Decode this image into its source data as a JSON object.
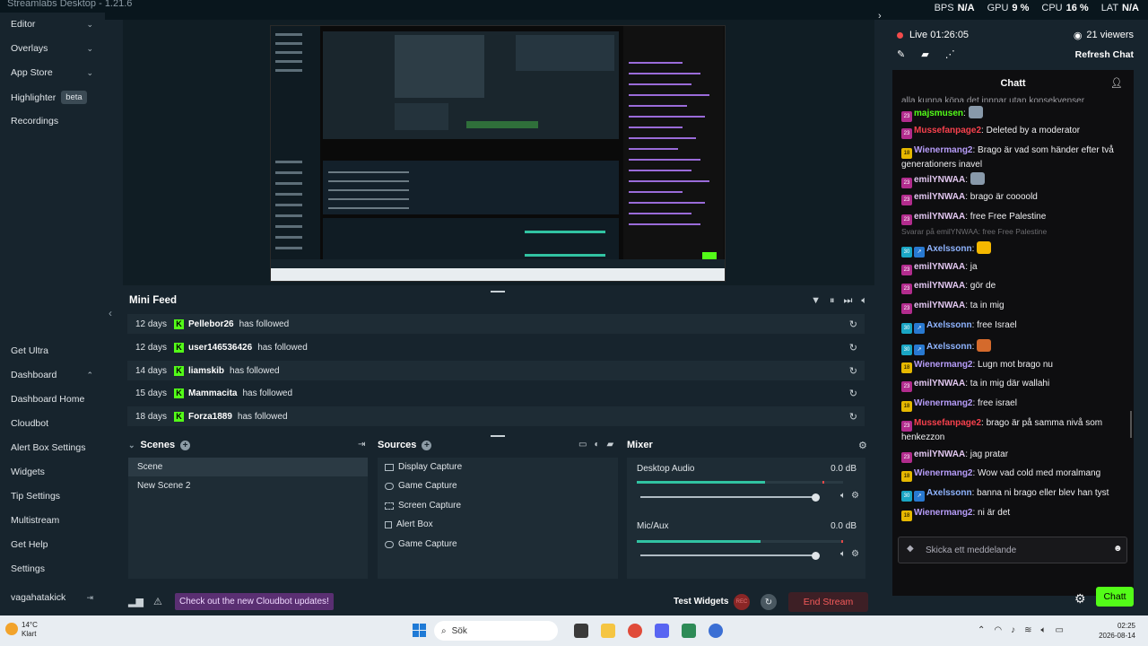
{
  "window": {
    "title": "Streamlabs Desktop - 1.21.6"
  },
  "stats": [
    {
      "label": "BPS",
      "value": "N/A"
    },
    {
      "label": "GPU",
      "value": "9 %"
    },
    {
      "label": "CPU",
      "value": "16 %"
    },
    {
      "label": "LAT",
      "value": "N/A"
    }
  ],
  "sidebar": {
    "top_items": [
      {
        "label": "Editor",
        "chevron": "down"
      },
      {
        "label": "Overlays",
        "chevron": "down"
      },
      {
        "label": "App Store",
        "chevron": "down"
      },
      {
        "label": "Highlighter",
        "badge": "beta"
      },
      {
        "label": "Recordings"
      }
    ],
    "bottom_items": [
      {
        "label": "Get Ultra"
      },
      {
        "label": "Dashboard",
        "chevron": "up"
      },
      {
        "label": "Dashboard Home"
      },
      {
        "label": "Cloudbot"
      },
      {
        "label": "Alert Box Settings"
      },
      {
        "label": "Widgets"
      },
      {
        "label": "Tip Settings"
      },
      {
        "label": "Multistream"
      },
      {
        "label": "Get Help"
      },
      {
        "label": "Settings"
      }
    ],
    "user": "vagahatakick"
  },
  "minifeed": {
    "title": "Mini Feed",
    "rows": [
      {
        "time": "12 days",
        "user": "Pellebor26",
        "action": "has followed"
      },
      {
        "time": "12 days",
        "user": "user146536426",
        "action": "has followed"
      },
      {
        "time": "14 days",
        "user": "liamskib",
        "action": "has followed"
      },
      {
        "time": "15 days",
        "user": "Mammacita",
        "action": "has followed"
      },
      {
        "time": "18 days",
        "user": "Forza1889",
        "action": "has followed"
      }
    ]
  },
  "scenes": {
    "title": "Scenes",
    "items": [
      "Scene",
      "New Scene 2"
    ]
  },
  "sources": {
    "title": "Sources",
    "items": [
      {
        "label": "Display Capture",
        "icon": "monitor-icon"
      },
      {
        "label": "Game Capture",
        "icon": "gamepad-icon"
      },
      {
        "label": "Screen Capture",
        "icon": "region-icon"
      },
      {
        "label": "Alert Box",
        "icon": "bell-icon"
      },
      {
        "label": "Game Capture",
        "icon": "gamepad-icon"
      }
    ]
  },
  "mixer": {
    "title": "Mixer",
    "channels": [
      {
        "label": "Desktop Audio",
        "db": "0.0 dB",
        "level": 0.62,
        "volume": 1.0
      },
      {
        "label": "Mic/Aux",
        "db": "0.0 dB",
        "level": 0.6,
        "volume": 1.0
      }
    ]
  },
  "statusbar": {
    "banner": "Check out the new Cloudbot updates!",
    "test_widgets": "Test Widgets",
    "rec_label": "REC",
    "end_stream": "End Stream"
  },
  "live": {
    "status": "Live 01:26:05",
    "viewers": "21 viewers",
    "refresh": "Refresh Chat"
  },
  "chat": {
    "title": "Chatt",
    "input_placeholder": "Skicka ett meddelande",
    "send_label": "Chatt",
    "cut_top": "alla kunna köpa det innnar utan konsekvenser",
    "reply_note": "Svarar på emilYNWAA: free Free Palestine",
    "messages": [
      {
        "badge": "23",
        "user": "majsmusen",
        "color": "#53fc18",
        "text": "",
        "emote": true
      },
      {
        "badge": "23",
        "user": "Mussefanpage2",
        "color": "#f7414d",
        "text": "Deleted by a moderator"
      },
      {
        "badge": "18",
        "user": "Wienermang2",
        "color": "#b69cf8",
        "text": "Brago är vad som händer efter två generationers inavel"
      },
      {
        "badge": "23",
        "user": "emilYNWAA",
        "color": "#e2c7f0",
        "text": "",
        "emote": true
      },
      {
        "badge": "23",
        "user": "emilYNWAA",
        "color": "#e2c7f0",
        "text": "brago är coooold"
      },
      {
        "badge": "23",
        "user": "emilYNWAA",
        "color": "#e2c7f0",
        "text": "free Free Palestine"
      },
      {
        "badge": "30",
        "user": "Axelssonn",
        "color": "#8fb4ff",
        "text": "",
        "emote": true
      },
      {
        "badge": "23",
        "user": "emilYNWAA",
        "color": "#e2c7f0",
        "text": "ja"
      },
      {
        "badge": "23",
        "user": "emilYNWAA",
        "color": "#e2c7f0",
        "text": "gör de"
      },
      {
        "badge": "23",
        "user": "emilYNWAA",
        "color": "#e2c7f0",
        "text": "ta in mig"
      },
      {
        "badge": "30",
        "user": "Axelssonn",
        "color": "#8fb4ff",
        "text": "free Israel"
      },
      {
        "badge": "30",
        "user": "Axelssonn",
        "color": "#8fb4ff",
        "text": "",
        "emote": true
      },
      {
        "badge": "18",
        "user": "Wienermang2",
        "color": "#b69cf8",
        "text": "Lugn mot brago nu"
      },
      {
        "badge": "23",
        "user": "emilYNWAA",
        "color": "#e2c7f0",
        "text": "ta in mig där wallahi"
      },
      {
        "badge": "18",
        "user": "Wienermang2",
        "color": "#b69cf8",
        "text": "free israel"
      },
      {
        "badge": "23",
        "user": "Mussefanpage2",
        "color": "#f7414d",
        "text": "brago är på samma nivå som henkezzon"
      },
      {
        "badge": "23",
        "user": "emilYNWAA",
        "color": "#e2c7f0",
        "text": "jag pratar"
      },
      {
        "badge": "18",
        "user": "Wienermang2",
        "color": "#b69cf8",
        "text": "Wow vad cold med moralmang"
      },
      {
        "badge": "30",
        "user": "Axelssonn",
        "color": "#8fb4ff",
        "text": "banna ni brago eller blev han tyst"
      },
      {
        "badge": "18",
        "user": "Wienermang2",
        "color": "#b69cf8",
        "text": "ni är det"
      }
    ]
  },
  "taskbar": {
    "temp": "14°C",
    "weather": "Klart",
    "search": "Sök",
    "time": "02:25",
    "date": "2026-08-14"
  },
  "colors": {
    "accent": "#53fc18",
    "live": "#f34b4b",
    "end_stream": "#f55a5a"
  }
}
